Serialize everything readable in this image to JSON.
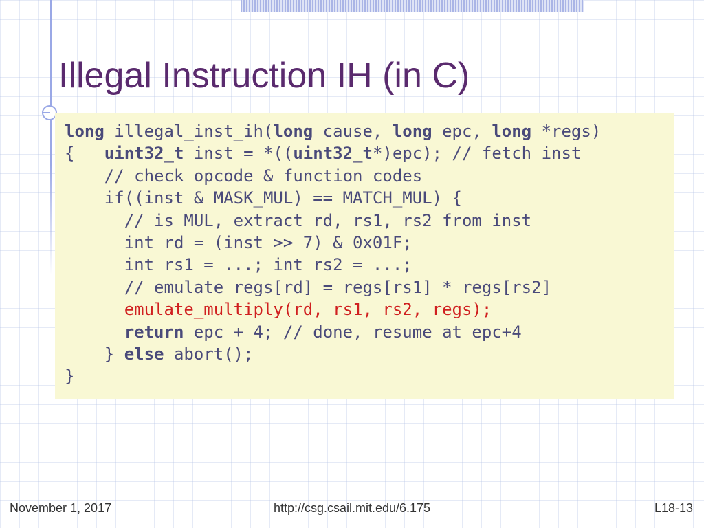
{
  "title": "Illegal Instruction IH (in C)",
  "code": {
    "l1a": "long",
    "l1b": " illegal_inst_ih(",
    "l1c": "long",
    "l1d": " cause, ",
    "l1e": "long",
    "l1f": " epc, ",
    "l1g": "long",
    "l1h": " *regs)",
    "l2a": "{   ",
    "l2b": "uint32_t",
    "l2c": " inst = *((",
    "l2d": "uint32_t",
    "l2e": "*)epc); // fetch inst",
    "l3": "    // check opcode & function codes",
    "l4": "    if((inst & MASK_MUL) == MATCH_MUL) {",
    "l5": "      // is MUL, extract rd, rs1, rs2 from inst",
    "l6": "      int rd = (inst >> 7) & 0x01F;",
    "l7": "      int rs1 = ...; int rs2 = ...;",
    "l8": "      // emulate regs[rd] = regs[rs1] * regs[rs2]",
    "l9": "      emulate_multiply(rd, rs1, rs2, regs);",
    "l10a": "      ",
    "l10b": "return",
    "l10c": " epc + 4; // done, resume at epc+4",
    "l11a": "    } ",
    "l11b": "else",
    "l11c": " abort();",
    "l12": "}"
  },
  "footer": {
    "date": "November 1, 2017",
    "url": "http://csg.csail.mit.edu/6.175",
    "page": "L18-13"
  }
}
